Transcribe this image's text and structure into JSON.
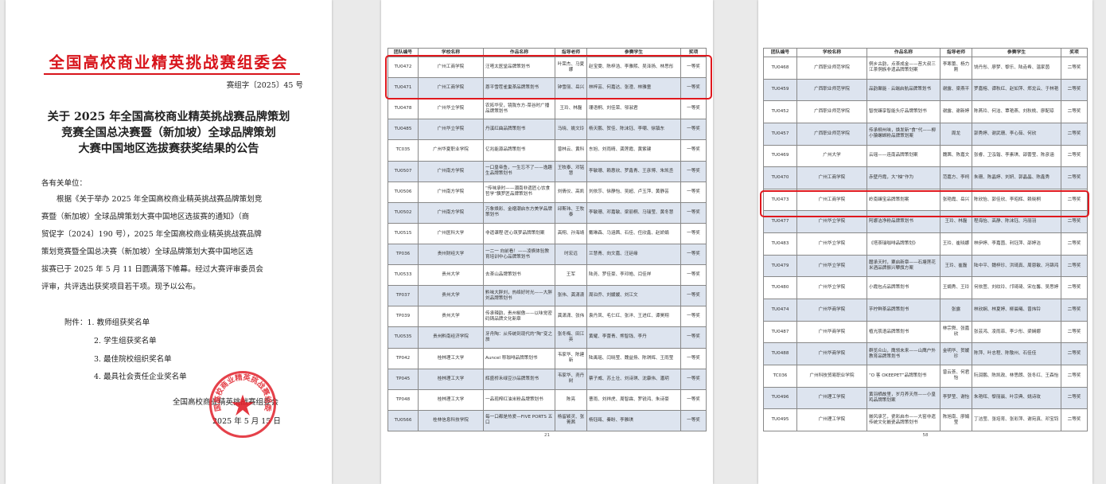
{
  "notice": {
    "org_header": "全国高校商业精英挑战赛组委会",
    "doc_no": "赛组字〔2025〕45 号",
    "title_lines": [
      "关于 2025 年全国高校商业精英挑战赛品牌策划",
      "竞赛全国总决赛暨（新加坡）全球品牌策划",
      "大赛中国地区选拔赛获奖结果的公告"
    ],
    "greeting": "各有关单位：",
    "body_lines": [
      "　　根据《关于举办 2025 年全国高校商业精英挑战赛品牌策划竞",
      "赛暨（新加坡）全球品牌策划大赛中国地区选拔赛的通知》（商",
      "贸促字〔2024〕190 号），2025 年全国高校商业精英挑战赛品牌",
      "策划竞赛暨全国总决赛（新加坡）全球品牌策划大赛中国地区选",
      "拔赛已于 2025 年 5 月 11 日圆满落下帷幕。经过大赛评审委员会",
      "评审，共评选出获奖项目若干项。现予以公布。"
    ],
    "attachments": [
      "附件：1. 教师组获奖名单",
      "2. 学生组获奖名单",
      "3. 最佳院校组织奖名单",
      "4. 最具社会责任企业奖名单"
    ],
    "signature": "全国高校商业精英挑战赛组委会",
    "date": "2025 年 5 月 15 日",
    "seal_text": "全国高校商业精英挑战赛组委会"
  },
  "table_headers": [
    "团队编号",
    "学校名称",
    "作品名称",
    "指导老师",
    "参赛学生",
    "奖项"
  ],
  "page2": {
    "page_number": "21",
    "rows": [
      [
        "TU0472",
        "广州工商学院",
        "汪嗒太医堂品牌策划书",
        "叶荣杰、马夏娜",
        "赵宝雯、陈梓浩、李雅熙、吴泽扬、林思彤",
        "一等奖"
      ],
      [
        "TU0471",
        "广州工商学院",
        "恩平雪茬雀巢茶品牌策划书",
        "钟雪丽、岳兴",
        "林梓芸、何嘉达、张澄、林雅童",
        "一等奖"
      ],
      [
        "TU0478",
        "广州华立学院",
        "农拓华安，镜陇东方-菜谷时广播品牌策划书",
        "王玲、林磊",
        "珊语桐、刘佳荣、邬淑君",
        "一等奖"
      ],
      [
        "TU0485",
        "广州华立学院",
        "丹溪红曲品牌策划书",
        "马晓、姚文玲",
        "杨天鹏、贺佳、陈沫钰、李嘲、徐镇东",
        "一等奖"
      ],
      [
        "TC035",
        "广州华夏职业学院",
        "亿兆能源品牌策划书",
        "曾林云、黄科",
        "东旭、刘雨晴、龚莲霞、黄紫键",
        "一等奖"
      ],
      [
        "TU0507",
        "广州南方学院",
        "一口皇帝鱼，一生忘不了——逸趣生品牌策划书",
        "王牧泰、邓铭慧",
        "李敏珊、赖惠欣、罗鑫青、王彦博、朱凯丞",
        "一等奖"
      ],
      [
        "TU0506",
        "广州南方学院",
        "“传味承时——潮南非遗匠心饮食哲学”飘罗匠品牌策划书",
        "刘倩仪、高凯",
        "刘依莎、徐静怡、吴超、卢玉萍、黄静芸",
        "一等奖"
      ],
      [
        "TU0502",
        "广州南方学院",
        "万象焕彩、金缯潮启东方美学品牌策划书",
        "邱斯玮、王牧泰",
        "李敏珊、邓嘉敏、梁丽桐、马瑞莹、黄冬慧",
        "一等奖"
      ],
      [
        "TU0515",
        "广州医科大学",
        "非遗课程·匠心筑梦品牌策划案",
        "高翔、孙海靖",
        "戴琳森、马涵茜、石佳、任欣鑫、赵娇娟",
        "一等奖"
      ],
      [
        "TP036",
        "贵州财经大学",
        "一二一 向前看！——凌枫体验教育培训中心品牌策划书",
        "时宏远",
        "兰慧青、向文嘉、汪廷缘",
        "一等奖"
      ],
      [
        "TU0533",
        "贵州大学",
        "去茶山品牌策划书",
        "王军",
        "陆尧、罗佳豪、李邓皓、闫佳祥",
        "一等奖"
      ],
      [
        "TP037",
        "贵州大学",
        "黔味大胖刘，热络好时光——大胖刘品牌策划书",
        "张伟、龚潇潇",
        "周泊乔、刘媛媛、刘江文",
        "一等奖"
      ],
      [
        "TP039",
        "贵州大学",
        "传承辣韵，贵州椒傲——以味觉密码铸品牌文化新章",
        "龚潇潇、张伟",
        "袁丹凤、毛仁红、张洋、王进红、谭昊翔",
        "一等奖"
      ],
      [
        "TU0535",
        "贵州黔南经济学院",
        "牙舟陶：从传统到现代的“陶”变之旅",
        "张冬梅、田江英",
        "黄耀、李蕾青、熊智钱、李丹",
        "一等奖"
      ],
      [
        "TP042",
        "桂林理工大学",
        "Auncel 称珈啡品牌策划书",
        "韦家华、陈建新",
        "陆禹瑶、闫晓莹、魏益扬、陈琪辉、王雨莹",
        "一等奖"
      ],
      [
        "TP045",
        "桂林理工大学",
        "辉盛桥禾绿豆沙品牌策划书",
        "韦家华、尧丹树",
        "蔡子威、苏土壮、刘诗琪、沈康伟、潘玥",
        "一等奖"
      ],
      [
        "TP048",
        "桂林理工大学",
        "一品现榨红油米粉品牌策划书",
        "陈亮",
        "曹雨、刘祥虎、周智霖、罗锐鸿、朱诗豪",
        "一等奖"
      ],
      [
        "TU0566",
        "桂林信息科技学院",
        "每一口都是热爱—FIVE PORTS 五口",
        "杨留颖灵、张菁茜",
        "杨钰瓯、秦盼、李雅琪",
        "一等奖"
      ]
    ]
  },
  "page3": {
    "page_number": "58",
    "rows": [
      [
        "TU0468",
        "广西职业师范学院",
        "侗乡古韵，点茶成金——苔大叔三江茶侗族非遗品牌策划案",
        "李寒蕾、杨力刚",
        "饶丹彤、廖梦、黎乐、陆垚希、温家茵",
        "二等奖"
      ],
      [
        "TU0459",
        "广西职业师范学院",
        "品韵聚能 · 云端启航品牌策划书",
        "谢露、梁燕平",
        "罗嘉榕、谭秋红、赵如萍、郑龙云、于林艳",
        "二等奖"
      ],
      [
        "TU0452",
        "广西职业师范学院",
        "智悦臻享智能头疗品牌策划书",
        "谢露、谢新婷",
        "陈燕玲、何洁、覃艳燕、刘秋桃、廖配琼",
        "二等奖"
      ],
      [
        "TU0457",
        "广西职业师范学院",
        "传承柳州味，焕发新“食”代——柳小猿螺蛳粉品牌策划案",
        "周龙",
        "郭秀婷、谢武珊、李心茹、何欣",
        "二等奖"
      ],
      [
        "TU0469",
        "广州大学",
        "云瑶——连南品牌策划案",
        "魏茜、陈嘉文",
        "张睿、卫泓锴、李素琪、邵蕾莹、陈彦涵",
        "二等奖"
      ],
      [
        "TU0470",
        "广州工商学院",
        "赤壁丹霞，大“柚”作为",
        "范嘉方、李柯",
        "朱珊、陈晶婷、刘妍、郭晶晶、陈鑫秀",
        "二等奖"
      ],
      [
        "TU0473",
        "广州工商学院",
        "岭南臻宝品牌策划案",
        "张艳霞、岳兴",
        "陈欣怡、郭佳欣、李昭辉、赖晓桐",
        "二等奖"
      ],
      [
        "TU0477",
        "广州华立学院",
        "阿娜洁净粉品牌策划书",
        "王玲、林磊",
        "程海怡、高静、陈沫钰、冯丽羽",
        "二等奖"
      ],
      [
        "TU0483",
        "广州华立学院",
        "《塔茶瑞咖啡品牌策划》",
        "王玲、崔晓娜",
        "林伊婷、李嘉茵、利钰萍、邵婷洁",
        "二等奖"
      ],
      [
        "TU0479",
        "广州华立学院",
        "醴承天时，粟启新章——石塘莲花米酒品牌振兴攀旗方案",
        "王玲、崔磊",
        "陆中平、魏梓珍、洪琦真、周恩敏、冯锦鸿",
        "二等奖"
      ],
      [
        "TU0480",
        "广州华立学院",
        "小霞包点品牌策划书",
        "王娟秀、王玲",
        "何依萱、刘纹玲、邝琦琦、宋在馨、吴思婷",
        "二等奖"
      ],
      [
        "TU0474",
        "广州华商学院",
        "芋柠鲜茶品牌策划书",
        "张露",
        "林欣娴、林夏婷、柳晨曦、曾炜铃",
        "二等奖"
      ],
      [
        "TU0487",
        "广州华商学院",
        "植光肌语品牌策划书",
        "林宗舜、张嘉欣",
        "张芸鸿、凌雨菲、李少彤、梁娴娜",
        "二等奖"
      ],
      [
        "TU0488",
        "广州华商学院",
        "群览众山，鹰领未来——山鹰户外教育品牌策划书",
        "金明华、贺媛珍",
        "陈萍、叶志程、陈敬州、石佳佳",
        "二等奖"
      ],
      [
        "TC036",
        "广州科技贸易职业学院",
        "“O 客 OKEEPET”品牌策划书",
        "曾云荟、何君怡",
        "阮润鹏、陈凯政、林思朗、张冬红、王森怡",
        "二等奖"
      ],
      [
        "TU0496",
        "广州理工学院",
        "黄羽栖故里，岁月养天然——小皇鸡品牌策划案",
        "李梦莹、谢怡",
        "朱艳晖、黎丽晨、叶宗典、姚诗玫",
        "二等奖"
      ],
      [
        "TU0495",
        "广州理工学院",
        "嵌风承艺，瓷彩启市——大窑非遗传统文化嵌瓷品牌策划书",
        "陈旭南、廖娟莹",
        "丁洁莹、张培育、张彩萍、谢宛真、邓宝钧",
        "二等奖"
      ]
    ]
  },
  "colors": {
    "accent_red": "#d8141b",
    "row_blue": "#dde4ef",
    "highlight": "#e0181e"
  }
}
